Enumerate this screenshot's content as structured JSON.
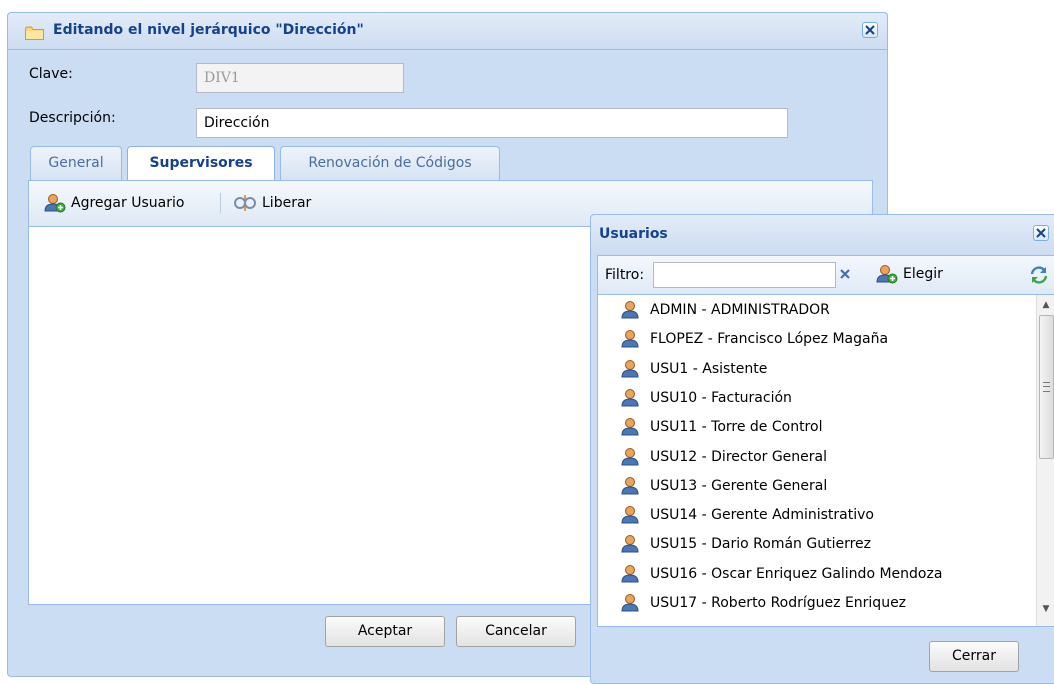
{
  "dialog": {
    "title": "Editando el nivel jerárquico \"Dirección\"",
    "icons": {
      "title": "folder-icon",
      "close": "close-icon"
    },
    "clave": {
      "label": "Clave:",
      "value": "DIV1"
    },
    "descripcion": {
      "label": "Descripción:",
      "value": "Dirección"
    },
    "tabs": [
      {
        "label": "General",
        "active": false
      },
      {
        "label": "Supervisores",
        "active": true
      },
      {
        "label": "Renovación de Códigos",
        "active": false
      }
    ],
    "toolbar": {
      "add_user": {
        "label": "Agregar Usuario",
        "icon": "user-add-icon"
      },
      "release": {
        "label": "Liberar",
        "icon": "release-icon"
      }
    },
    "buttons": {
      "accept": "Aceptar",
      "cancel": "Cancelar"
    }
  },
  "picker": {
    "title": "Usuarios",
    "filter": {
      "label": "Filtro:",
      "value": "",
      "placeholder": ""
    },
    "choose_label": "Elegir",
    "icons": {
      "clear": "clear-icon",
      "choose": "user-add-icon",
      "refresh": "refresh-icon",
      "item": "user-icon"
    },
    "items": [
      "ADMIN - ADMINISTRADOR",
      "FLOPEZ - Francisco López Magaña",
      "USU1 - Asistente",
      "USU10 - Facturación",
      "USU11 - Torre de Control",
      "USU12 - Director General",
      "USU13 - Gerente General",
      "USU14 - Gerente Administrativo",
      "USU15 - Dario Román Gutierrez",
      "USU16 - Oscar Enriquez Galindo Mendoza",
      "USU17 - Roberto Rodríguez Enriquez"
    ],
    "close_button": "Cerrar"
  },
  "colors": {
    "title_text": "#15428b",
    "frame": "#cbddf3",
    "border": "#99bbe8"
  }
}
